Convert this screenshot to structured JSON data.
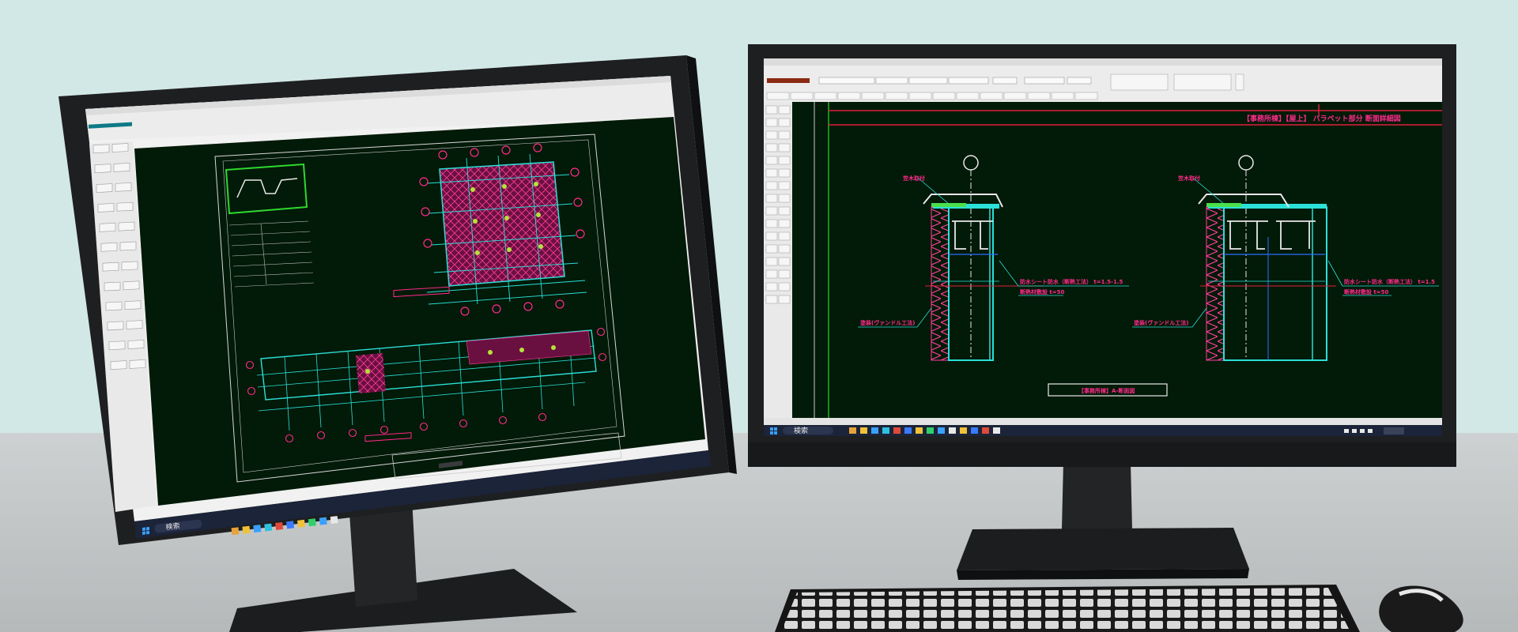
{
  "scene": {
    "description_objects": [
      "left-monitor",
      "right-monitor",
      "keyboard",
      "mouse",
      "desk"
    ],
    "colors": {
      "wall": "#d2e8e6",
      "desk": "#c4c9ca",
      "monitor_bezel": "#1e1f21",
      "cad_background": "#021a08",
      "cad_cyan": "#2be0d8",
      "cad_magenta": "#ff2a8a",
      "cad_green": "#4be04b",
      "cad_red": "#e0203a",
      "taskbar": "#1b2438"
    }
  },
  "left_monitor": {
    "taskbar": {
      "search_label": "検索"
    }
  },
  "right_monitor": {
    "taskbar": {
      "search_label": "検索"
    },
    "drawing": {
      "header_label": "【事務所棟】【屋上】 パラペット部分 断面詳細図",
      "left_section": {
        "label_top": "笠木取付",
        "label_right": "防水シート防水（断熱工法） t=1.5-1.5",
        "label_right_2": "断熱材敷設 t=50",
        "label_left_bottom": "塗装(ヴァンドル工法)"
      },
      "right_section": {
        "label_top": "笠木取付",
        "label_right": "防水シート防水（断熱工法） t=1.5",
        "label_right_2": "断熱材敷設 t=50",
        "label_left_bottom": "塗装(ヴァンドル工法)"
      },
      "footer_label": "【事務所棟】A-断面図"
    }
  }
}
